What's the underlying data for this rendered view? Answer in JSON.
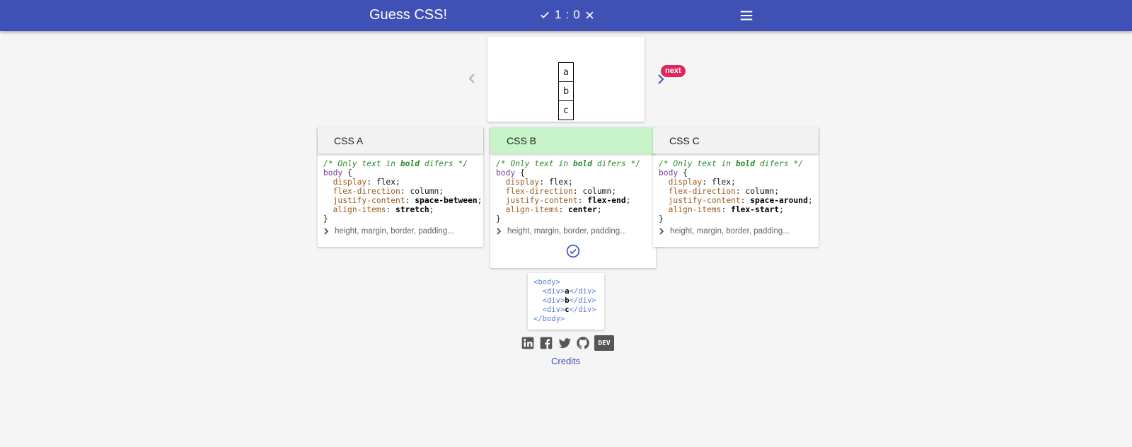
{
  "header": {
    "title": "Guess CSS!",
    "score_correct": "1",
    "score_separator": ":",
    "score_wrong": "0"
  },
  "preview": {
    "boxes": [
      "a",
      "b",
      "c"
    ]
  },
  "nav": {
    "next_label": "next"
  },
  "cards": [
    {
      "title": "CSS A",
      "selected": false,
      "comment_pre": "/* Only text in ",
      "comment_bold": "bold",
      "comment_post": " difers */",
      "selector": "body",
      "open": " {",
      "props": [
        {
          "name": "display",
          "value": "flex",
          "bold": false
        },
        {
          "name": "flex-direction",
          "value": "column",
          "bold": false
        },
        {
          "name": "justify-content",
          "value": "space-between",
          "bold": true
        },
        {
          "name": "align-items",
          "value": "stretch",
          "bold": true
        }
      ],
      "close": "}",
      "more_label": "height, margin, border, padding..."
    },
    {
      "title": "CSS B",
      "selected": true,
      "comment_pre": "/* Only text in ",
      "comment_bold": "bold",
      "comment_post": " difers */",
      "selector": "body",
      "open": " {",
      "props": [
        {
          "name": "display",
          "value": "flex",
          "bold": false
        },
        {
          "name": "flex-direction",
          "value": "column",
          "bold": false
        },
        {
          "name": "justify-content",
          "value": "flex-end",
          "bold": true
        },
        {
          "name": "align-items",
          "value": "center",
          "bold": true
        }
      ],
      "close": "}",
      "more_label": "height, margin, border, padding..."
    },
    {
      "title": "CSS C",
      "selected": false,
      "comment_pre": "/* Only text in ",
      "comment_bold": "bold",
      "comment_post": " difers */",
      "selector": "body",
      "open": " {",
      "props": [
        {
          "name": "display",
          "value": "flex",
          "bold": false
        },
        {
          "name": "flex-direction",
          "value": "column",
          "bold": false
        },
        {
          "name": "justify-content",
          "value": "space-around",
          "bold": true
        },
        {
          "name": "align-items",
          "value": "flex-start",
          "bold": true
        }
      ],
      "close": "}",
      "more_label": "height, margin, border, padding..."
    }
  ],
  "html_code": {
    "body_open": "<body>",
    "div_open": "<div>",
    "div_close": "</div>",
    "body_close": "</body>",
    "children": [
      "a",
      "b",
      "c"
    ]
  },
  "footer": {
    "icons": [
      "linkedin-icon",
      "facebook-icon",
      "twitter-icon",
      "github-icon",
      "dev-icon"
    ],
    "dev_label": "DEV",
    "credits_label": "Credits"
  },
  "colors": {
    "brand": "#3f51b5",
    "selected_card": "#c8f4c9",
    "next_badge": "#e0245e"
  }
}
